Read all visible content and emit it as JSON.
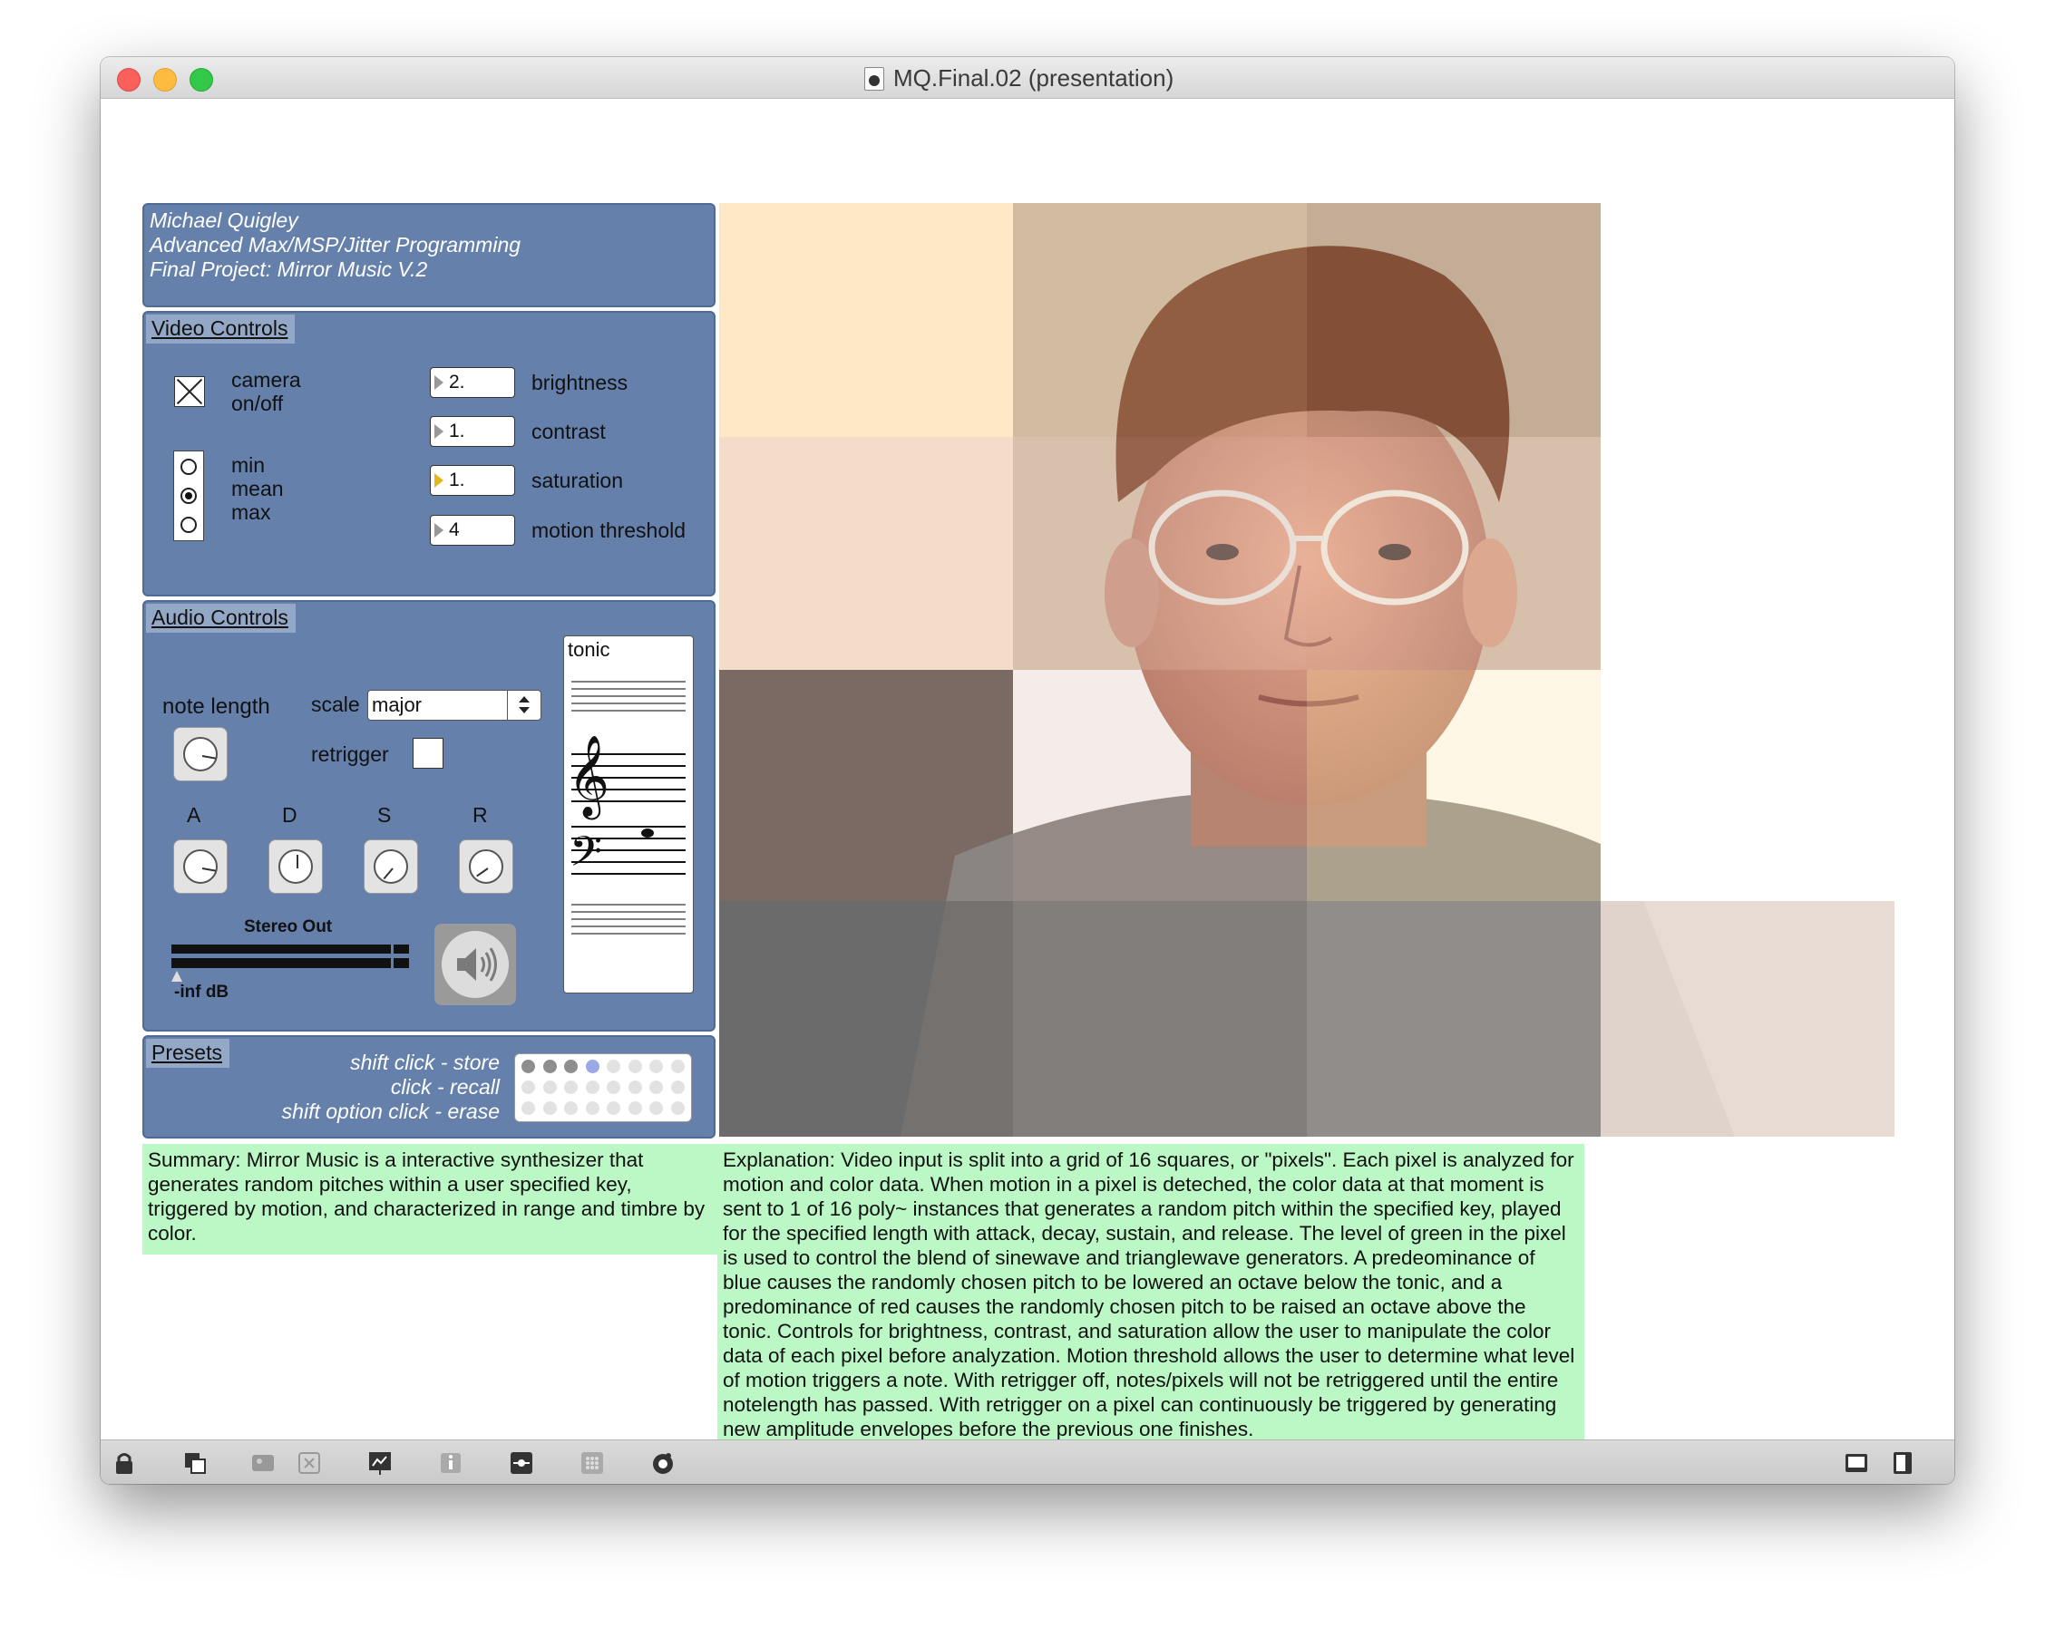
{
  "window": {
    "title": "MQ.Final.02 (presentation)"
  },
  "header": {
    "author": "Michael Quigley",
    "course": "Advanced Max/MSP/Jitter Programming",
    "project": "Final Project: Mirror Music V.2"
  },
  "video_controls": {
    "section_label": "Video Controls",
    "camera_label_line1": "camera",
    "camera_label_line2": "on/off",
    "camera_on": true,
    "mode_options": [
      "min",
      "mean",
      "max"
    ],
    "mode_selected": "mean",
    "brightness": {
      "value": "2.",
      "label": "brightness"
    },
    "contrast": {
      "value": "1.",
      "label": "contrast"
    },
    "saturation": {
      "value": "1.",
      "label": "saturation"
    },
    "motion_threshold": {
      "value": "4",
      "label": "motion threshold"
    }
  },
  "audio_controls": {
    "section_label": "Audio Controls",
    "note_length_label": "note length",
    "scale_label": "scale",
    "scale_value": "major",
    "retrigger_label": "retrigger",
    "retrigger_checked": false,
    "envelope_labels": [
      "A",
      "D",
      "S",
      "R"
    ],
    "tonic_label": "tonic",
    "meter_label": "Stereo Out",
    "meter_value": "-inf dB"
  },
  "presets": {
    "section_label": "Presets",
    "hint_store": "shift click - store",
    "hint_recall": "click - recall",
    "hint_erase": "shift option click - erase"
  },
  "summary": "Summary: Mirror Music is a interactive synthesizer that generates random pitches within a user specified key, triggered by motion, and characterized in range and timbre by color.",
  "explanation": "Explanation: Video input is split into a grid of 16 squares, or \"pixels\". Each pixel is analyzed for motion and color data. When motion in a pixel is deteched, the color data at that moment is sent to 1 of 16 poly~ instances that generates a random pitch within the specified key, played for the specified length with attack, decay, sustain, and release. The level of green in the pixel is used to control the blend of sinewave and trianglewave generators. A predeominance of blue causes the randomly chosen pitch to be lowered an octave below the tonic, and  a predominance of red causes the randomly chosen pitch to be raised an octave above the tonic. Controls for brightness, contrast, and saturation allow the user to manipulate the color data of each pixel before analyzation. Motion threshold allows the user to determine what level of motion triggers a note. With retrigger off, notes/pixels will not be retriggered until the entire notelength has passed. With retrigger on a pixel can continuously be triggered by generating new amplitude envelopes before the previous one finishes.",
  "toolbar": {
    "icons": [
      "lock-icon",
      "new-view-icon",
      "palette-icon",
      "close-patch-icon",
      "presentation-icon",
      "info-icon",
      "patch-cord-icon",
      "grid-icon",
      "console-icon",
      "left-sidebar-icon",
      "right-sidebar-icon"
    ]
  },
  "colors": {
    "panel": "#6581ab",
    "section_tab": "#93a7c6",
    "note_box": "#bcf7c6",
    "titlebar": "#e0e0e0",
    "close": "#fc605c",
    "minimize": "#fdbc40",
    "zoom": "#34c84a"
  }
}
